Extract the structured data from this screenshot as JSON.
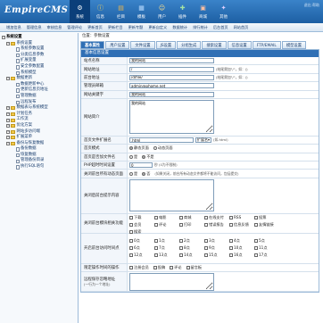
{
  "header": {
    "logo": "EmpireCMS",
    "links": "退出  帮助",
    "nav": [
      {
        "label": "系统",
        "icon": "gear-icon",
        "glyph": "⚙",
        "color": "#ffffff"
      },
      {
        "label": "信息",
        "icon": "info-icon",
        "glyph": "ⓘ",
        "color": "#f7d35b"
      },
      {
        "label": "栏目",
        "icon": "folder-icon",
        "glyph": "▤",
        "color": "#f0b74a"
      },
      {
        "label": "模板",
        "icon": "template-icon",
        "glyph": "▦",
        "color": "#b8dbff"
      },
      {
        "label": "用户",
        "icon": "user-icon",
        "glyph": "☺",
        "color": "#ffe08a"
      },
      {
        "label": "插件",
        "icon": "plugin-icon",
        "glyph": "✚",
        "color": "#a4e3a4"
      },
      {
        "label": "商城",
        "icon": "shop-icon",
        "glyph": "▣",
        "color": "#ffbfa0"
      },
      {
        "label": "其他",
        "icon": "other-icon",
        "glyph": "✦",
        "color": "#e0d0ff"
      }
    ]
  },
  "subnav": [
    "增加信息",
    "管理信息",
    "审核信息",
    "管理评论",
    "更新首页",
    "更新栏目",
    "更新专题",
    "更新自定义",
    "数据统计",
    "排行统计",
    "后台首页",
    "网站首页"
  ],
  "sidebar": [
    {
      "label": "系统设置",
      "type": "root"
    },
    {
      "label": "系统设置",
      "type": "folder"
    },
    {
      "label": "系统参数设置",
      "type": "page"
    },
    {
      "label": "分类信息参数",
      "type": "page"
    },
    {
      "label": "扩展变量",
      "type": "page"
    },
    {
      "label": "安全参数配置",
      "type": "page"
    },
    {
      "label": "系统模型",
      "type": "page"
    },
    {
      "label": "数据更新",
      "type": "folder"
    },
    {
      "label": "数据更新中心",
      "type": "page"
    },
    {
      "label": "更新信息页地址",
      "type": "page"
    },
    {
      "label": "管理数据",
      "type": "page"
    },
    {
      "label": "远程发布",
      "type": "page"
    },
    {
      "label": "数据表与系统模型",
      "type": "folder"
    },
    {
      "label": "计划任务",
      "type": "folder"
    },
    {
      "label": "工作流",
      "type": "folder"
    },
    {
      "label": "优化方案",
      "type": "folder"
    },
    {
      "label": "网站多访问端",
      "type": "folder"
    },
    {
      "label": "扩展菜单",
      "type": "folder"
    },
    {
      "label": "备份与恢复数据",
      "type": "folder"
    },
    {
      "label": "备份数据",
      "type": "page"
    },
    {
      "label": "恢复数据",
      "type": "page"
    },
    {
      "label": "管理备份目录",
      "type": "page"
    },
    {
      "label": "执行SQL语句",
      "type": "page"
    }
  ],
  "main": {
    "breadcrumb": "位置：参数设置",
    "tabs": [
      "基本属性",
      "用户设置",
      "文件设置",
      "JS设置",
      "分组生成",
      "搜索设置",
      "信息设置",
      "FTP/EMAIL",
      "模型设置"
    ],
    "section_title": "基本信息设置",
    "fields": {
      "site_name": {
        "label": "站点名称",
        "value": "我的网站"
      },
      "site_url": {
        "label": "网站地址",
        "value": "/",
        "hint": "(结尾需加\"/\"，如：/)"
      },
      "admin_path": {
        "label": "前台地址",
        "value": "/d/file/",
        "hint": "(结尾需加\"/\"，如：/)"
      },
      "email": {
        "label": "管理员邮箱",
        "value": "admin@phome.net"
      },
      "keywords": {
        "label": "网站关键字",
        "value": "我的网站"
      },
      "description": {
        "label": "网站简介",
        "value": "我的网站"
      },
      "index_file": {
        "label": "首页文件扩展名",
        "value": ".html",
        "select": "扩展名",
        "hint": "(如.html)"
      },
      "index_mode": {
        "label": "首页模式",
        "options": [
          "静态页面",
          "动态页面"
        ],
        "selected": 0
      },
      "index_name": {
        "label": "首页是否加文件名",
        "options": [
          "是",
          "不是"
        ],
        "selected": 1
      },
      "php_time": {
        "label": "PHP超时时间设置",
        "value": "0",
        "hint": "秒 (0为不限制)"
      },
      "close_site": {
        "label": "关闭前台所有动态页面",
        "options": [
          "是",
          "否"
        ],
        "selected": 1,
        "hint": "(如果关闭，前台所有动态文件都将不能访问，包括提交)"
      },
      "close_tip": {
        "label": "关闭后前台提示内容"
      },
      "close_modules": {
        "label": "关闭前台模块相关功能",
        "options": [
          "下载",
          "电影",
          "商城",
          "在线支付",
          "RSS",
          "投票",
          "会员",
          "评论",
          "打印",
          "错误报告",
          "信息反馈",
          "友情链接",
          "搜索"
        ]
      },
      "open_hours": {
        "label": "开启前台访问时间点",
        "options": [
          "0点",
          "1点",
          "2点",
          "3点",
          "4点",
          "5点",
          "6点",
          "7点",
          "8点",
          "9点",
          "10点",
          "11点",
          "12点",
          "13点",
          "14点",
          "15点",
          "16点",
          "17点"
        ]
      },
      "limit_ops": {
        "label": "限定操作时间的操作",
        "options": [
          "注册会员",
          "投稿",
          "评论",
          "留言板"
        ]
      },
      "limit_ip": {
        "label": "远程保存忽略地址",
        "hint": "(一行为一个地址)"
      }
    }
  }
}
